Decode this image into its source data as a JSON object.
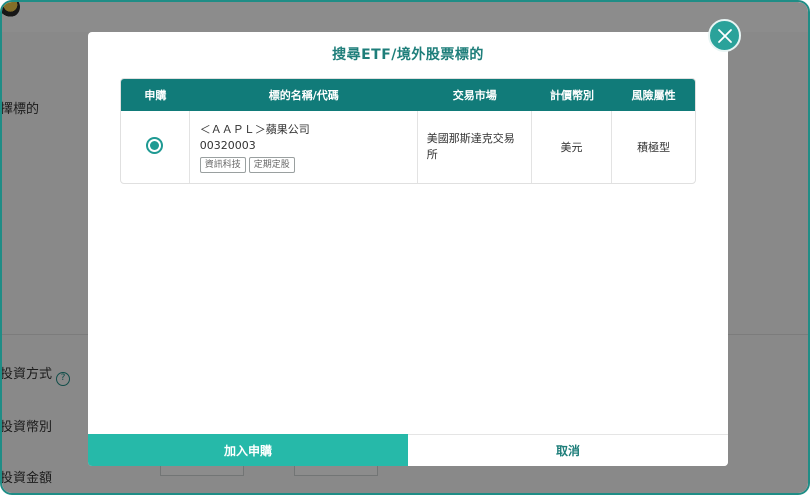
{
  "background": {
    "select_label": "擇標的",
    "invest_method_label": "投資方式",
    "currency_label": "投資幣別",
    "amount_label": "投資金額"
  },
  "modal": {
    "title": "搜尋ETF/境外股票標的",
    "table": {
      "headers": [
        "申購",
        "標的名稱/代碼",
        "交易市場",
        "計價幣別",
        "風險屬性"
      ],
      "rows": [
        {
          "selected": true,
          "name": "＜ＡＡＰＬ＞蘋果公司",
          "code": "00320003",
          "tags": [
            "資訊科技",
            "定期定股"
          ],
          "market": "美國那斯達克交易所",
          "currency": "美元",
          "risk": "積極型"
        }
      ]
    },
    "buttons": {
      "confirm": "加入申購",
      "cancel": "取消"
    }
  },
  "colors": {
    "accent": "#117b79",
    "button": "#26b9a9",
    "close_button": "#2aa29a"
  }
}
